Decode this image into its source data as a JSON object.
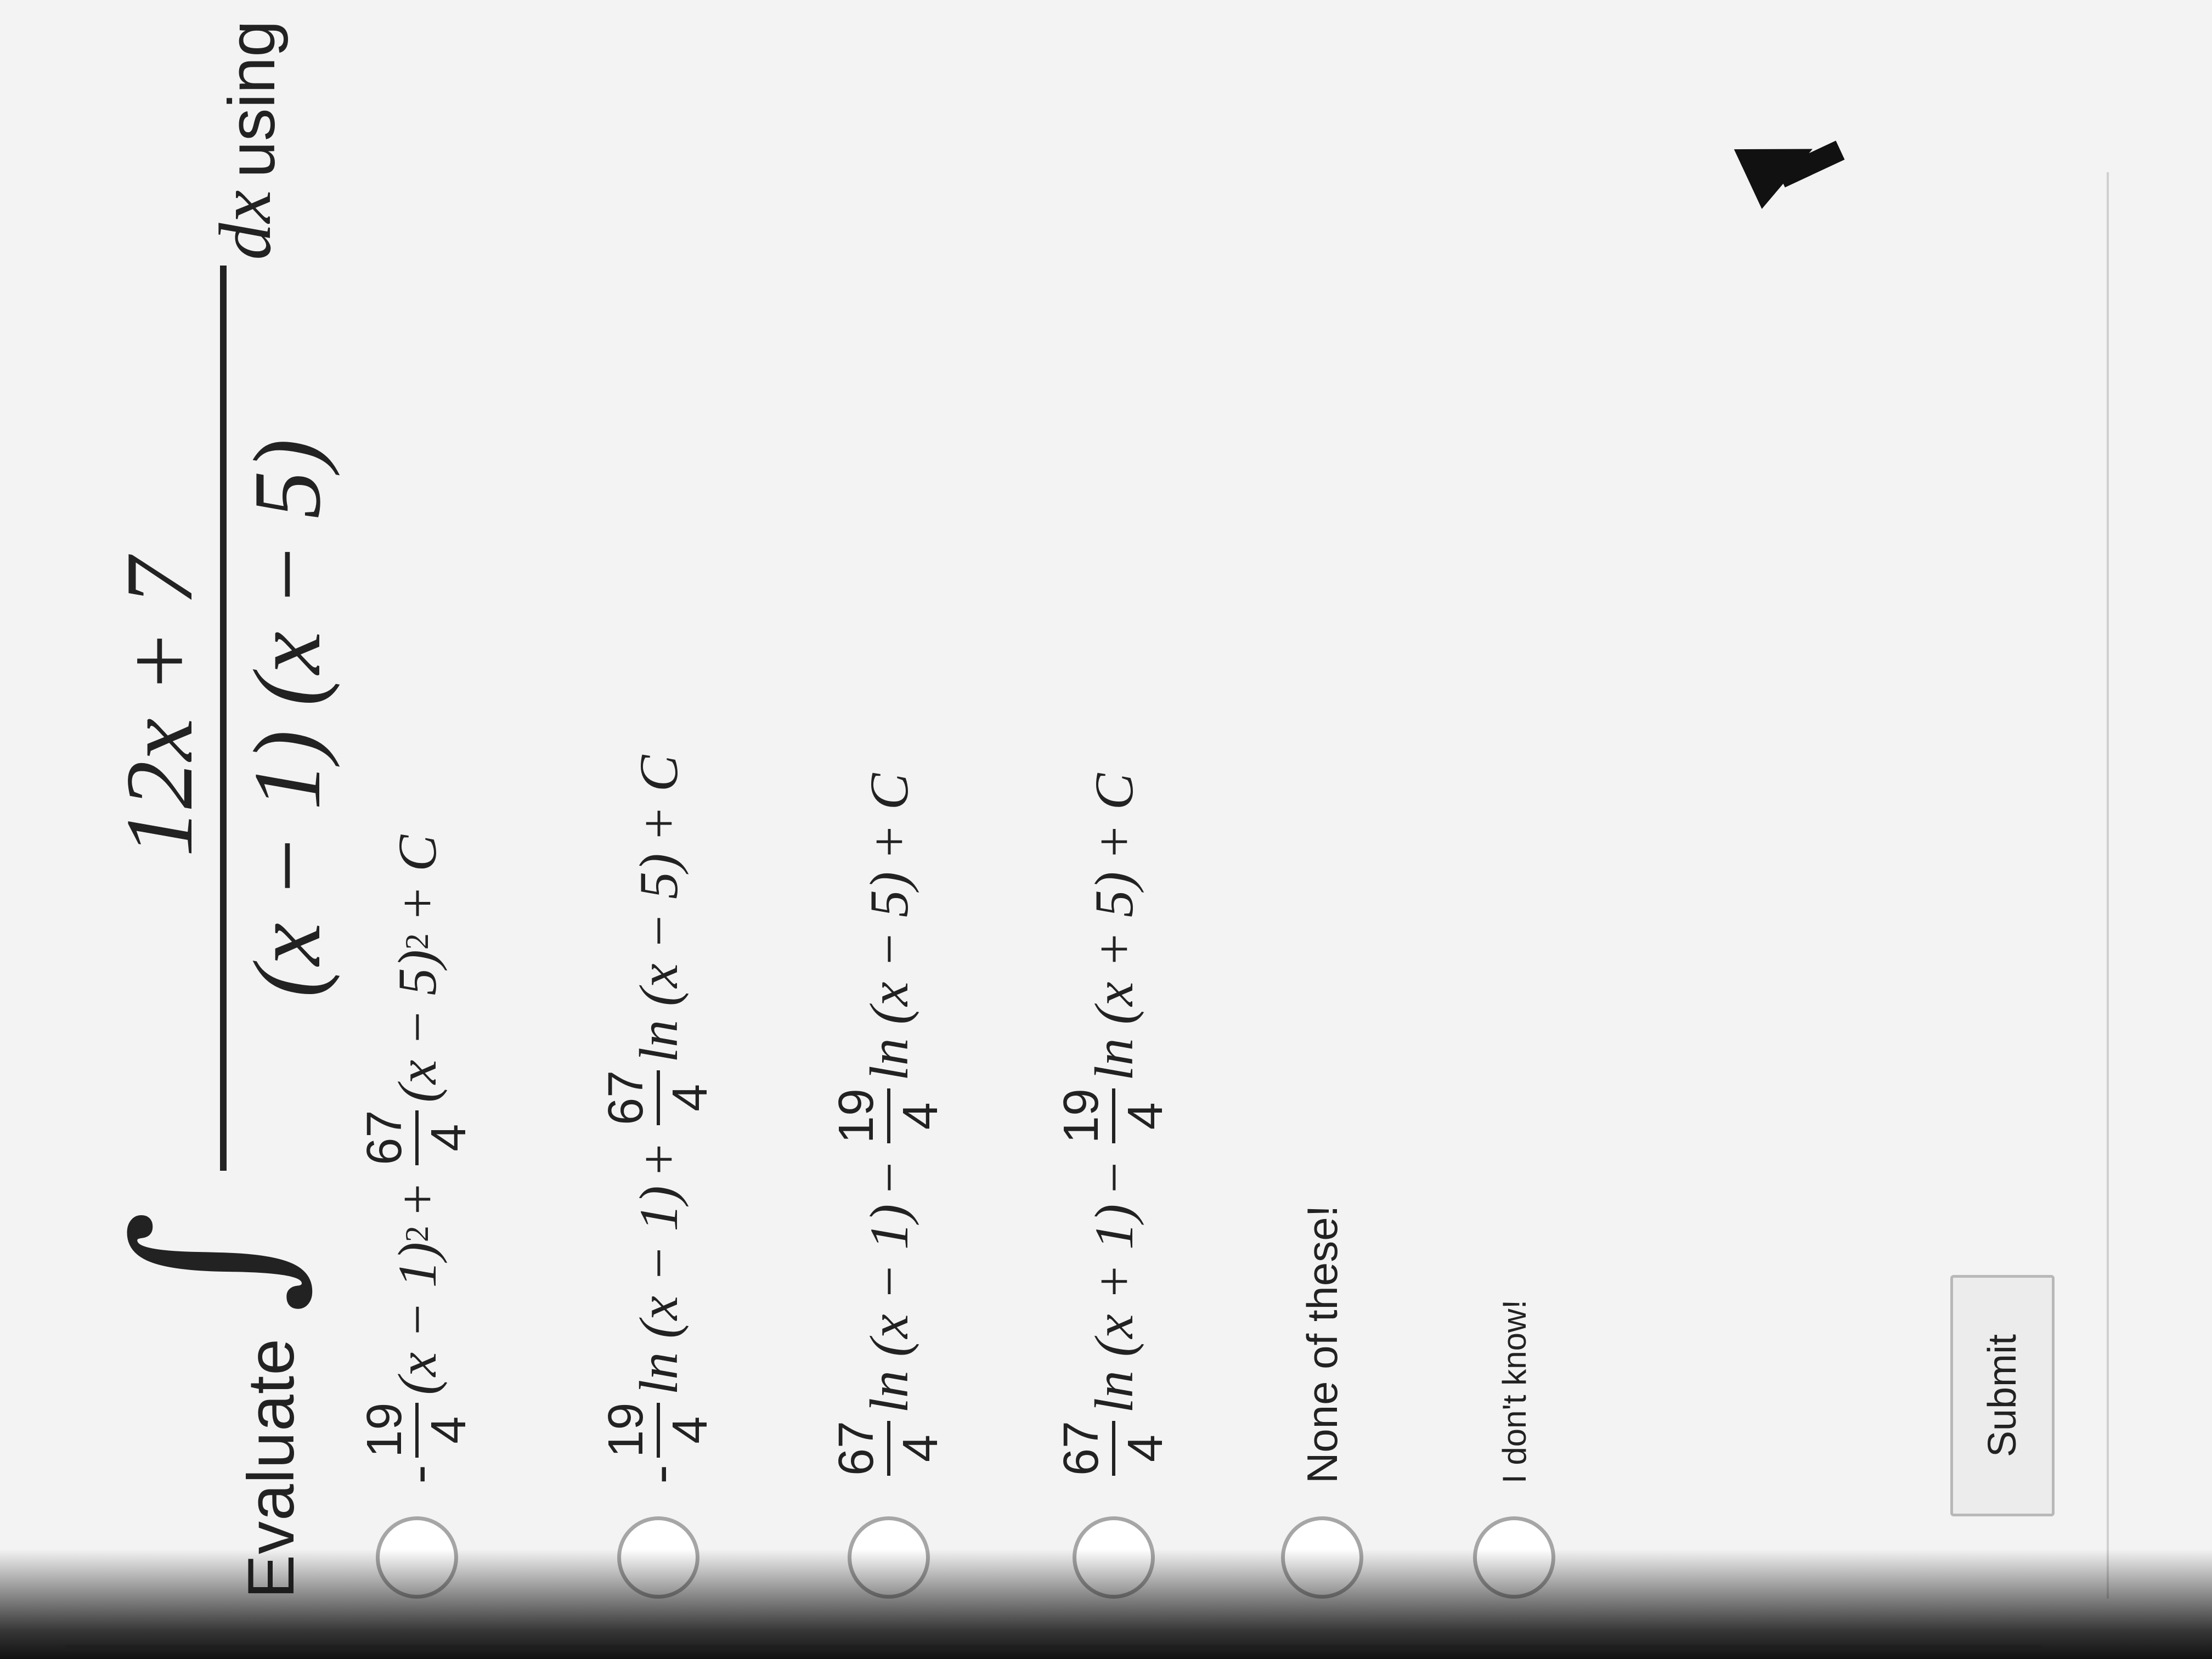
{
  "question": {
    "prefix": "Evaluate",
    "integral_symbol": "∫",
    "numerator": "12x + 7",
    "denominator": "(x − 1) (x − 5)",
    "differential": "dx",
    "suffix": "using partial fractions."
  },
  "options": [
    {
      "lead_sign": "-",
      "f1_num": "19",
      "f1_den": "4",
      "t1": "(x − 1)",
      "p1": "2",
      "op": "+",
      "f2_num": "67",
      "f2_den": "4",
      "t2": "(x − 5)",
      "p2": "2",
      "end": "+ C"
    },
    {
      "lead_sign": "-",
      "f1_num": "19",
      "f1_den": "4",
      "t1": "ln (x − 1)",
      "op": "+",
      "f2_num": "67",
      "f2_den": "4",
      "t2": "ln (x − 5)",
      "end": "+ C"
    },
    {
      "lead_sign": "",
      "f1_num": "67",
      "f1_den": "4",
      "t1": "ln (x − 1)",
      "op": "−",
      "f2_num": "19",
      "f2_den": "4",
      "t2": "ln (x − 5)",
      "end": "+ C"
    },
    {
      "lead_sign": "",
      "f1_num": "67",
      "f1_den": "4",
      "t1": "ln (x + 1)",
      "op": "−",
      "f2_num": "19",
      "f2_den": "4",
      "t2": "ln (x + 5)",
      "end": "+ C"
    }
  ],
  "none_option": "None of these!",
  "dont_know_option": "I don't know!",
  "submit_label": "Submit",
  "colors": {
    "text": "#222222",
    "radio_border": "#a6a6a6",
    "page_bg": "#f3f3f3"
  }
}
